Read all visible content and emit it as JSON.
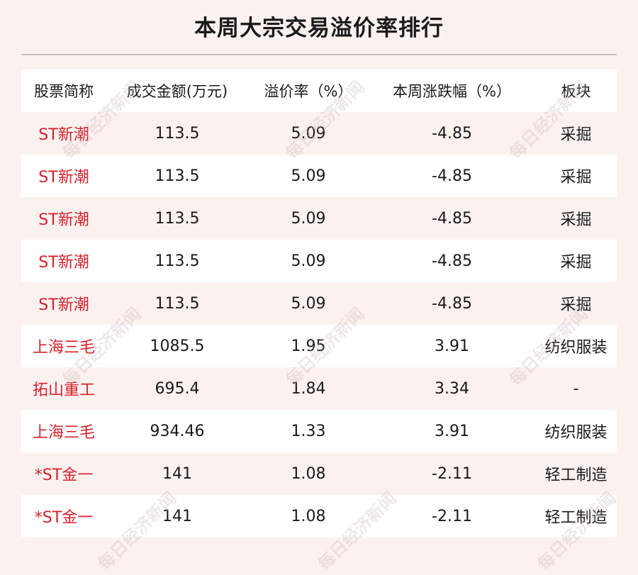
{
  "title": "本周大宗交易溢价率排行",
  "watermark": "每日经济新闻",
  "headers": [
    "股票简称",
    "成交金额(万元)",
    "溢价率（%）",
    "本周涨跌幅（%）",
    "板块"
  ],
  "rows": [
    {
      "name": "ST新潮",
      "amount": "113.5",
      "premium": "5.09",
      "change": "-4.85",
      "sector": "采掘"
    },
    {
      "name": "ST新潮",
      "amount": "113.5",
      "premium": "5.09",
      "change": "-4.85",
      "sector": "采掘"
    },
    {
      "name": "ST新潮",
      "amount": "113.5",
      "premium": "5.09",
      "change": "-4.85",
      "sector": "采掘"
    },
    {
      "name": "ST新潮",
      "amount": "113.5",
      "premium": "5.09",
      "change": "-4.85",
      "sector": "采掘"
    },
    {
      "name": "ST新潮",
      "amount": "113.5",
      "premium": "5.09",
      "change": "-4.85",
      "sector": "采掘"
    },
    {
      "name": "上海三毛",
      "amount": "1085.5",
      "premium": "1.95",
      "change": "3.91",
      "sector": "纺织服装"
    },
    {
      "name": "拓山重工",
      "amount": "695.4",
      "premium": "1.84",
      "change": "3.34",
      "sector": "-"
    },
    {
      "name": "上海三毛",
      "amount": "934.46",
      "premium": "1.33",
      "change": "3.91",
      "sector": "纺织服装"
    },
    {
      "name": "*ST金一",
      "amount": "141",
      "premium": "1.08",
      "change": "-2.11",
      "sector": "轻工制造"
    },
    {
      "name": "*ST金一",
      "amount": "141",
      "premium": "1.08",
      "change": "-2.11",
      "sector": "轻工制造"
    }
  ],
  "colors": {
    "name_red": "#d6212b",
    "background": "#fbf2f0",
    "stripe": "#ffffff"
  }
}
